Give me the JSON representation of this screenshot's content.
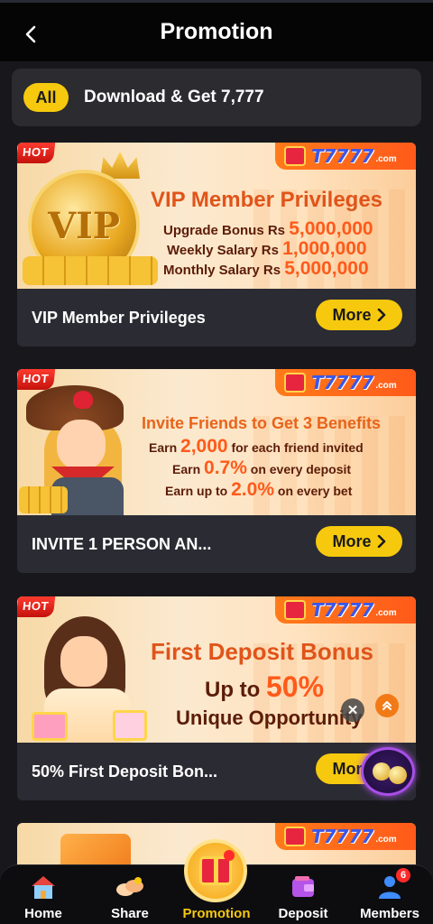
{
  "header": {
    "title": "Promotion"
  },
  "filters": {
    "all_label": "All",
    "download_label": "Download & Get 7,777"
  },
  "brand": {
    "text": "T7777",
    "suffix": ".com",
    "hot": "HOT"
  },
  "cards": [
    {
      "title": "VIP Member Privileges",
      "more_label": "More",
      "banner": {
        "heading": "VIP Member Privileges",
        "coin_text": "VIP",
        "lines": [
          {
            "label": "Upgrade Bonus Rs",
            "value": "5,000,000"
          },
          {
            "label": "Weekly Salary Rs",
            "value": "1,000,000"
          },
          {
            "label": "Monthly Salary Rs",
            "value": "5,000,000"
          }
        ]
      }
    },
    {
      "title": "INVITE 1 PERSON AN...",
      "more_label": "More",
      "banner": {
        "heading": "Invite Friends to Get 3 Benefits",
        "lines": [
          {
            "prefix": "Earn",
            "value": "2,000",
            "suffix": "for each friend invited"
          },
          {
            "prefix": "Earn",
            "value": "0.7%",
            "suffix": "on every deposit"
          },
          {
            "prefix": "Earn up to",
            "value": "2.0%",
            "suffix": "on every bet"
          }
        ]
      }
    },
    {
      "title": "50% First Deposit Bon...",
      "more_label": "More",
      "banner": {
        "heading": "First Deposit Bonus",
        "line1_prefix": "Up to",
        "line1_value": "50%",
        "line2": "Unique Opportunity"
      }
    }
  ],
  "bottom_nav": [
    {
      "label": "Home",
      "icon": "home-icon"
    },
    {
      "label": "Share",
      "icon": "share-icon"
    },
    {
      "label": "Promotion",
      "icon": "gift-icon"
    },
    {
      "label": "Deposit",
      "icon": "wallet-icon"
    },
    {
      "label": "Members",
      "icon": "members-icon",
      "badge": "6"
    }
  ],
  "colors": {
    "accent": "#f6c90e",
    "background": "#18181c",
    "card": "#2b2b33",
    "promotion_active": "#f6c90e"
  }
}
